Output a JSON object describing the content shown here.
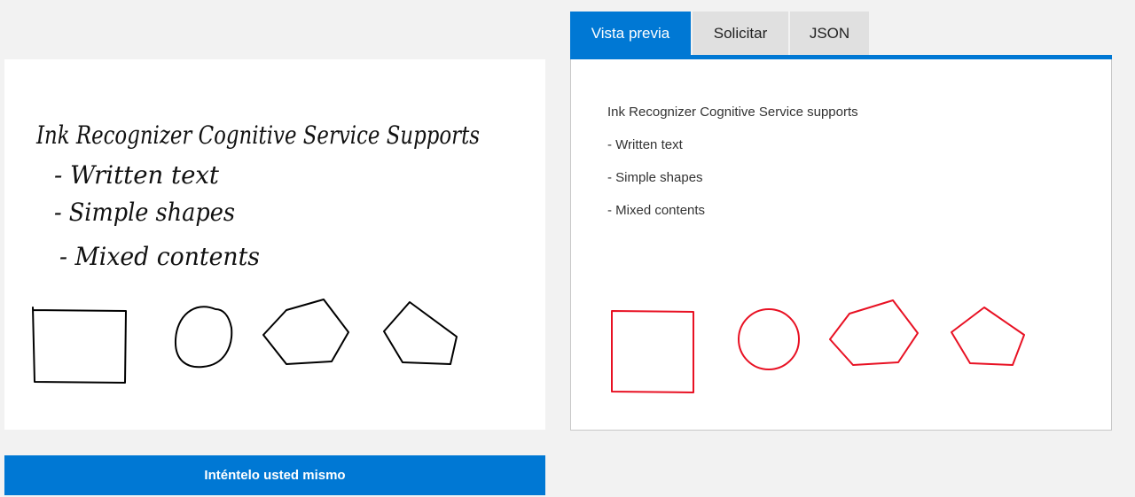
{
  "canvas": {
    "handwriting_lines": [
      "Ink Recognizer Cognitive Service Supports",
      "- Written text",
      "- Simple shapes",
      "- Mixed contents"
    ],
    "drawn_shapes": [
      "rectangle",
      "circle",
      "hexagon",
      "pentagon"
    ]
  },
  "actions": {
    "try_label": "Inténtelo usted mismo"
  },
  "tabs": [
    {
      "label": "Vista previa",
      "active": true
    },
    {
      "label": "Solicitar",
      "active": false
    },
    {
      "label": "JSON",
      "active": false
    }
  ],
  "preview": {
    "lines": [
      "Ink Recognizer Cognitive Service supports",
      "- Written text",
      "- Simple shapes",
      "- Mixed contents"
    ],
    "recognized_shapes": [
      "square",
      "circle",
      "hexagon",
      "pentagon"
    ]
  },
  "colors": {
    "accent": "#0078d4",
    "ink": "#000000",
    "recognized_shape_stroke": "#e81123",
    "background": "#f2f2f2",
    "tab_inactive": "#e0e0e0"
  }
}
